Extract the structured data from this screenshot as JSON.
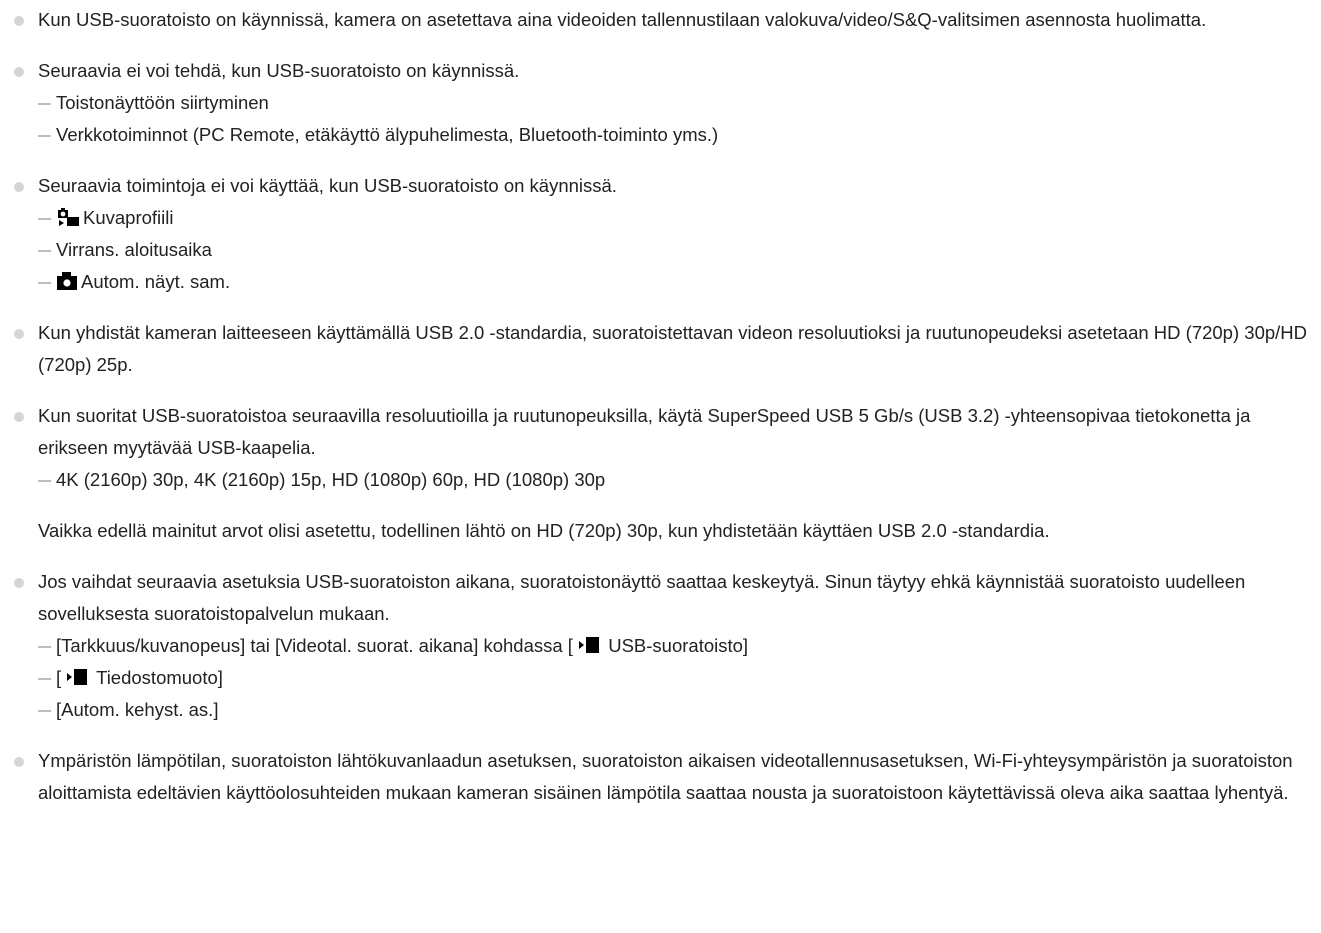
{
  "bullets": [
    {
      "text": "Kun USB-suoratoisto on käynnissä, kamera on asetettava aina videoiden tallennustilaan valokuva/video/S&Q-valitsimen asennosta huolimatta."
    },
    {
      "text": "Seuraavia ei voi tehdä, kun USB-suoratoisto on käynnissä.",
      "items": [
        "Toistonäyttöön siirtyminen",
        "Verkkotoiminnot (PC Remote, etäkäyttö älypuhelimesta, Bluetooth-toiminto yms.)"
      ]
    },
    {
      "text": "Seuraavia toimintoja ei voi käyttää, kun USB-suoratoisto on käynnissä.",
      "items": [
        "Kuvaprofiili",
        "Virrans. aloitusaika",
        "Autom. näyt. sam."
      ],
      "icons": [
        "camera-movie-icon",
        "camera-icon"
      ]
    },
    {
      "text": "Kun yhdistät kameran laitteeseen käyttämällä USB 2.0 -standardia, suoratoistettavan videon resoluutioksi ja ruutunopeudeksi asetetaan HD (720p) 30p/HD (720p) 25p."
    },
    {
      "text": "Kun suoritat USB-suoratoistoa seuraavilla resoluutioilla ja ruutunopeuksilla, käytä SuperSpeed USB 5 Gb/s (USB 3.2) -yhteensopivaa tietokonetta ja erikseen myytävää USB-kaapelia.",
      "items": [
        "4K (2160p) 30p, 4K (2160p) 15p, HD (1080p) 60p, HD (1080p) 30p"
      ],
      "note": "Vaikka edellä mainitut arvot olisi asetettu, todellinen lähtö on HD (720p) 30p, kun yhdistetään käyttäen USB 2.0 -standardia."
    },
    {
      "text": "Jos vaihdat seuraavia asetuksia USB-suoratoiston aikana, suoratoistonäyttö saattaa keskeytyä. Sinun täytyy ehkä käynnistää suoratoisto uudelleen sovelluksesta suoratoistopalvelun mukaan.",
      "item1_pre": "[Tarkkuus/kuvanopeus] tai [Videotal. suorat. aikana] kohdassa [",
      "item1_post": " USB-suoratoisto]",
      "item2_pre": "[",
      "item2_post": " Tiedostomuoto]",
      "item3": "[Autom. kehyst. as.]",
      "icons": [
        "movie-icon"
      ]
    },
    {
      "text": "Ympäristön lämpötilan, suoratoiston lähtökuvanlaadun asetuksen, suoratoiston aikaisen videotallennusasetuksen, Wi-Fi-yhteysympäristön ja suoratoiston aloittamista edeltävien käyttöolosuhteiden mukaan kameran sisäinen lämpötila saattaa nousta ja suoratoistoon käytettävissä oleva aika saattaa lyhentyä."
    }
  ]
}
